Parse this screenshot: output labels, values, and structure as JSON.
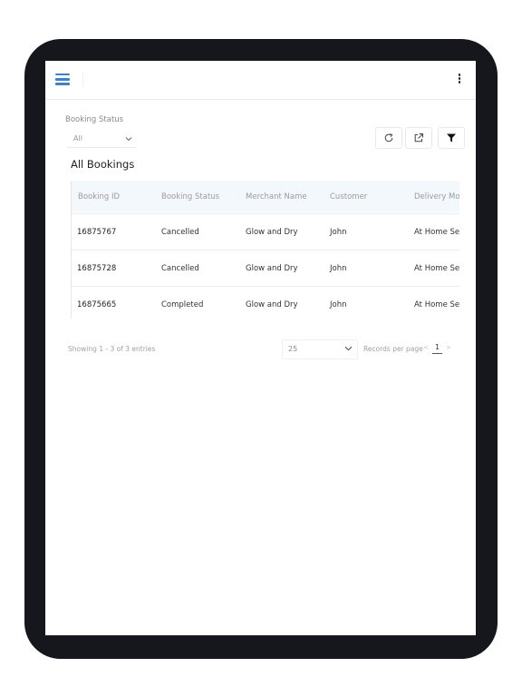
{
  "filters": {
    "booking_status_label": "Booking Status",
    "booking_status_value": "All"
  },
  "section": {
    "title": "All Bookings"
  },
  "table": {
    "columns": [
      "Booking ID",
      "Booking Status",
      "Merchant Name",
      "Customer",
      "Delivery Mo"
    ],
    "rows": [
      [
        "16875767",
        "Cancelled",
        "Glow and Dry",
        "John",
        "At Home Se"
      ],
      [
        "16875728",
        "Cancelled",
        "Glow and Dry",
        "John",
        "At Home Se"
      ],
      [
        "16875665",
        "Completed",
        "Glow and Dry",
        "John",
        "At Home Se"
      ]
    ]
  },
  "footer": {
    "entries_text": "Showing 1 - 3 of 3 entries",
    "page_size": "25",
    "records_per_page_label": "Records per page",
    "prev_arrow": "<",
    "next_arrow": ">",
    "current_page": "1"
  },
  "icons": {
    "menu": "hamburger-menu-icon",
    "more": "more-vertical-icon",
    "refresh": "refresh-icon",
    "export": "export-icon",
    "filter": "filter-icon",
    "dropdown": "chevron-down-icon"
  },
  "colors": {
    "accent": "#3d83c4",
    "header_bg": "#f3f8fd",
    "device_frame": "#15171c"
  }
}
